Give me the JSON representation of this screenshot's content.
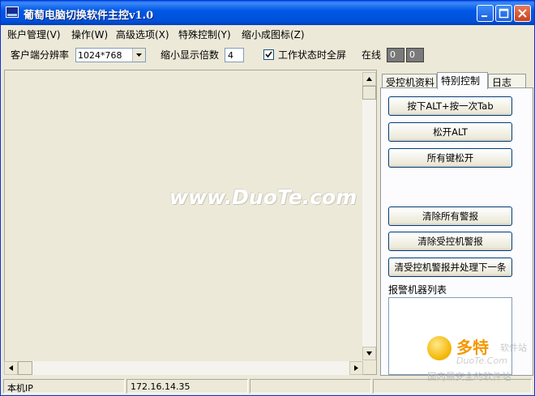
{
  "window": {
    "title": "葡萄电脑切换软件主控v1.0"
  },
  "menu": [
    "账户管理(V)",
    "操作(W)",
    "高级选项(X)",
    "特殊控制(Y)",
    "缩小成图标(Z)"
  ],
  "toolbar": {
    "resolution_label": "客户端分辨率",
    "resolution_value": "1024*768",
    "zoom_label": "缩小显示倍数",
    "zoom_value": "4",
    "fullscreen_label": "工作状态时全屏",
    "fullscreen_checked": true,
    "online_label": "在线",
    "online_count_a": "0",
    "online_count_b": "0"
  },
  "watermark": "www.DuoTe.com",
  "tabs": [
    "受控机资料",
    "特别控制",
    "日志"
  ],
  "active_tab": "特别控制",
  "buttons": {
    "alt_tab": "按下ALT+按一次Tab",
    "release_alt": "松开ALT",
    "release_all": "所有键松开",
    "clear_all_alarms": "清除所有警报",
    "clear_client_alarm": "清除受控机警报",
    "clear_and_next": "清受控机警报并处理下一条"
  },
  "alarm_list_label": "报警机器列表",
  "statusbar": {
    "ip_label": "本机IP",
    "ip_value": "172.16.14.35"
  },
  "corner_logo": {
    "brand_cn": "多特",
    "brand_small": "软件站",
    "brand_en": "DuoTe.Com",
    "tagline": "国内最安全的软件站"
  },
  "colors": {
    "titlebar": "#0054e3",
    "window_bg": "#ece9d8",
    "online_box": "#7a7a7a"
  }
}
